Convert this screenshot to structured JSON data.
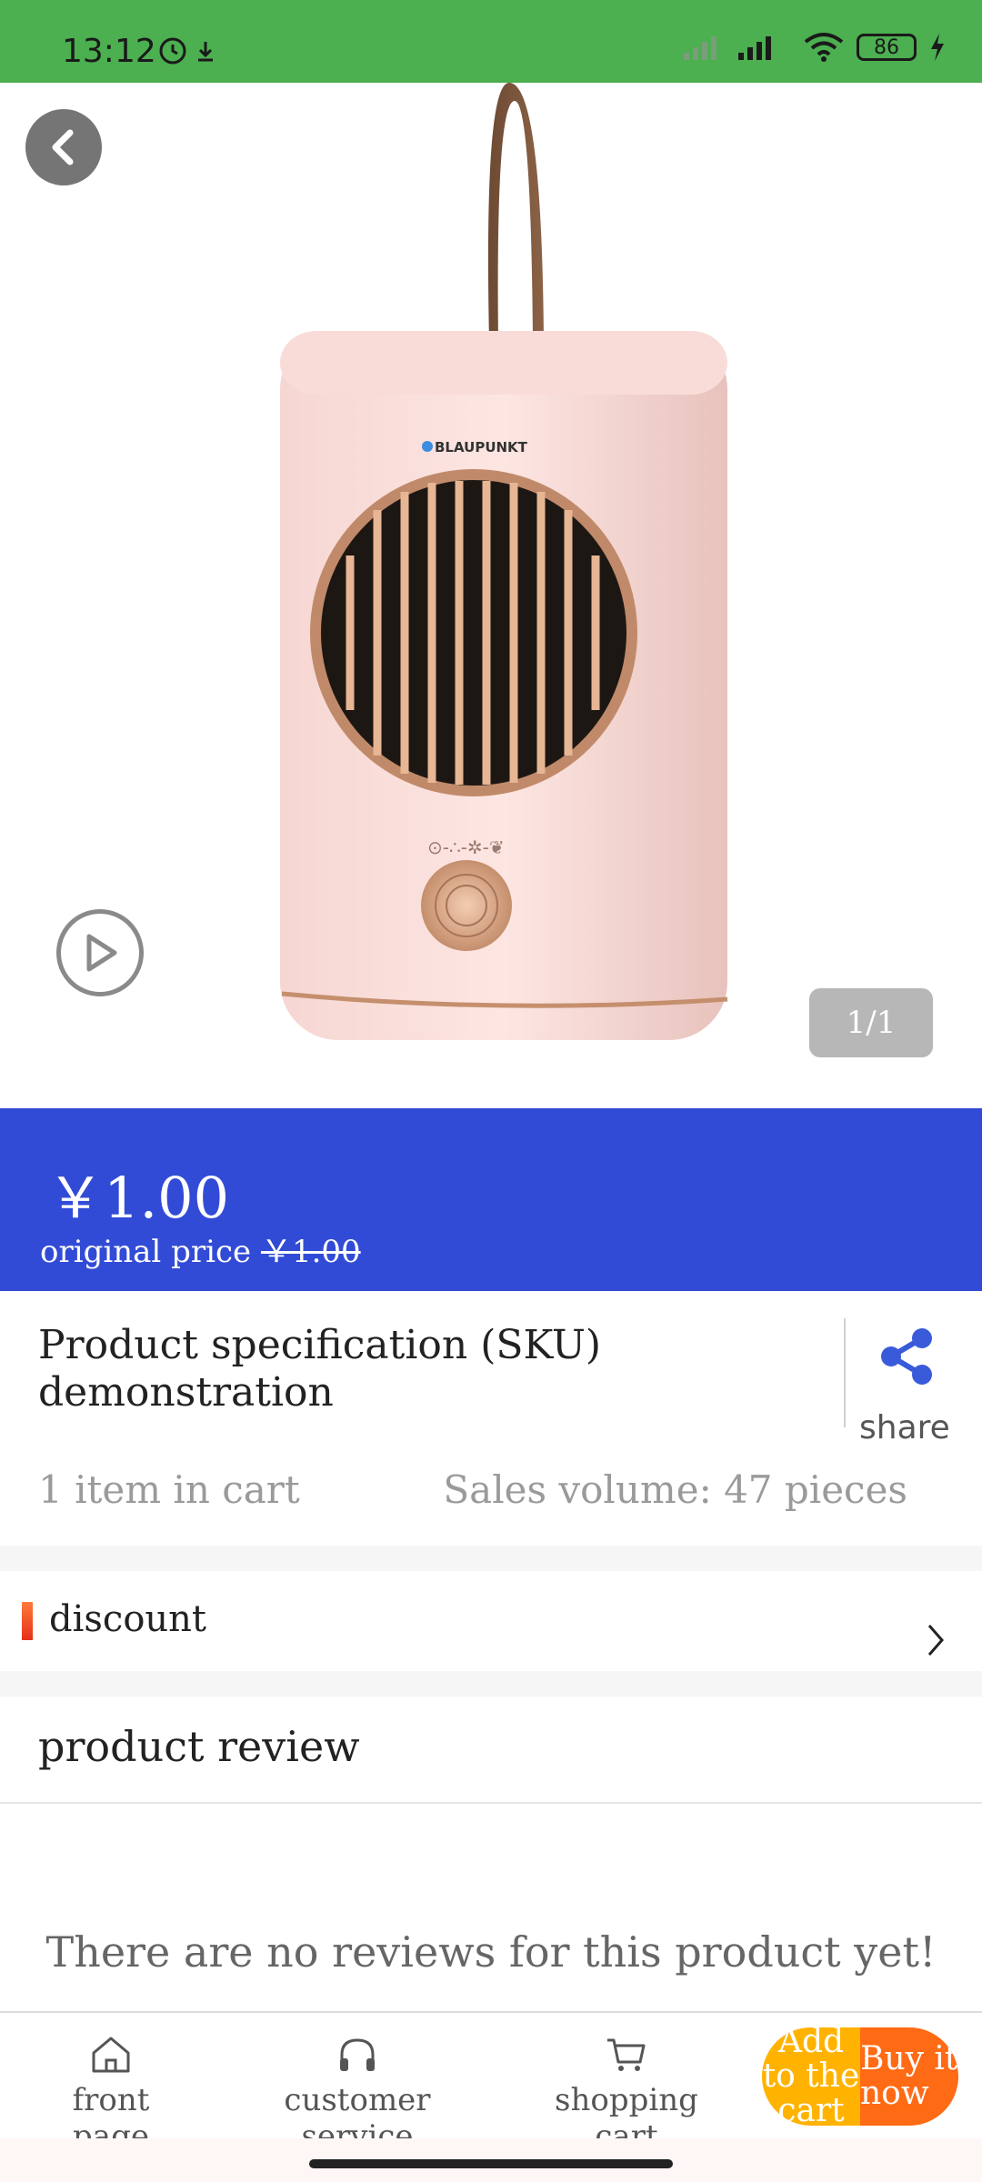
{
  "status": {
    "time": "13:12",
    "battery": "86"
  },
  "hero": {
    "counter": "1/1",
    "product_brand": "BLAUPUNKT"
  },
  "price": {
    "current": "￥1.00",
    "original_label": "original price",
    "original_value": "￥1.00"
  },
  "product": {
    "title": "Product specification (SKU) demonstration",
    "share_label": "share"
  },
  "meta": {
    "cart_count": "1 item in cart",
    "sales_volume": "Sales volume: 47 pieces"
  },
  "discount": {
    "label": "discount"
  },
  "reviews": {
    "title": "product review",
    "empty": "There are no reviews for this product yet!"
  },
  "bottom_nav": {
    "front_page": "front page",
    "customer_service": "customer service",
    "shopping_cart": "shopping cart",
    "add_to_cart": "Add to the cart",
    "buy_now": "Buy it now"
  },
  "colors": {
    "status_bar": "#4caf50",
    "price_band": "#324bd6",
    "add_cart": "#ffb300",
    "buy_now": "#ff6a14"
  }
}
